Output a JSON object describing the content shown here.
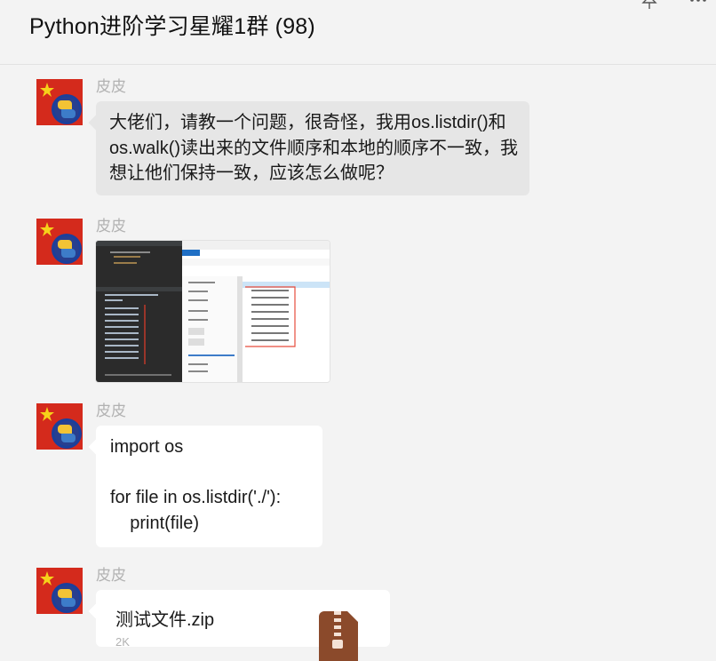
{
  "header": {
    "title": "Python进阶学习星耀1群 (98)",
    "pin_icon": "pin-icon",
    "more_icon": "more-icon"
  },
  "messages": [
    {
      "sender": "皮皮",
      "type": "text",
      "text": "大佬们，请教一个问题，很奇怪，我用os.listdir()和os.walk()读出来的文件顺序和本地的顺序不一致，我想让他们保持一致，应该怎么做呢？"
    },
    {
      "sender": "皮皮",
      "type": "image",
      "description": "screenshot-thumbnail"
    },
    {
      "sender": "皮皮",
      "type": "code",
      "lines": [
        "import os",
        "",
        "for file in os.listdir('./'):",
        "    print(file)"
      ]
    },
    {
      "sender": "皮皮",
      "type": "file",
      "file_name": "测试文件.zip",
      "file_size": "2K",
      "icon": "zip-file-icon"
    }
  ],
  "colors": {
    "background": "#f3f3f3",
    "incoming_bubble": "#e6e6e6",
    "white_bubble": "#ffffff",
    "sender_name": "#b2b2b2",
    "zip_icon": "#8b4a2b"
  }
}
